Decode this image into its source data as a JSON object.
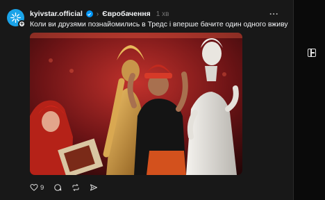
{
  "post": {
    "username": "kyivstar.official",
    "topic": "Євробачення",
    "time": "1 хв",
    "text": "Коли ви друзями познайомились в Тредс і вперше бачите один одного вживу",
    "likes": "9"
  },
  "icons": {
    "avatar": "kyivstar-star-icon",
    "verified": "verified-badge-icon",
    "more": "more-dots-icon",
    "like": "heart-icon",
    "reply": "comment-icon",
    "repost": "repost-icon",
    "share": "send-icon",
    "rail": "add-column-icon"
  },
  "colors": {
    "accent": "#0095f6",
    "brand": "#1aa3e8"
  }
}
